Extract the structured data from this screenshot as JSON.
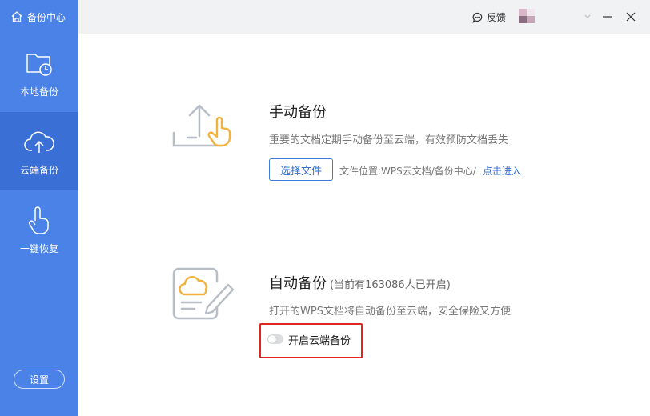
{
  "app": {
    "title": "备份中心"
  },
  "sidebar": {
    "items": [
      {
        "label": "本地备份",
        "icon": "folder-clock-icon",
        "active": false
      },
      {
        "label": "云端备份",
        "icon": "cloud-upload-icon",
        "active": true
      },
      {
        "label": "一键恢复",
        "icon": "hand-tap-icon",
        "active": false
      }
    ],
    "settings_label": "设置"
  },
  "titlebar": {
    "feedback_label": "反馈",
    "feedback_icon": "chat-bubble-icon"
  },
  "manual": {
    "title": "手动备份",
    "description": "重要的文档定期手动备份至云端，有效预防文档丢失",
    "button_label": "选择文件",
    "location_text": "文件位置:WPS云文档/备份中心/",
    "location_link": "点击进入"
  },
  "auto": {
    "title": "自动备份",
    "subtitle": "(当前有163086人已开启)",
    "description": "打开的WPS文档将自动备份至云端，安全保险又方便",
    "toggle_label": "开启云端备份",
    "toggle_on": false
  },
  "colors": {
    "sidebar_bg": "#4b82e8",
    "sidebar_active": "#3a6fd6",
    "accent": "#2f6fd3",
    "highlight_border": "#e0261e",
    "icon_yellow": "#f2b33d"
  }
}
